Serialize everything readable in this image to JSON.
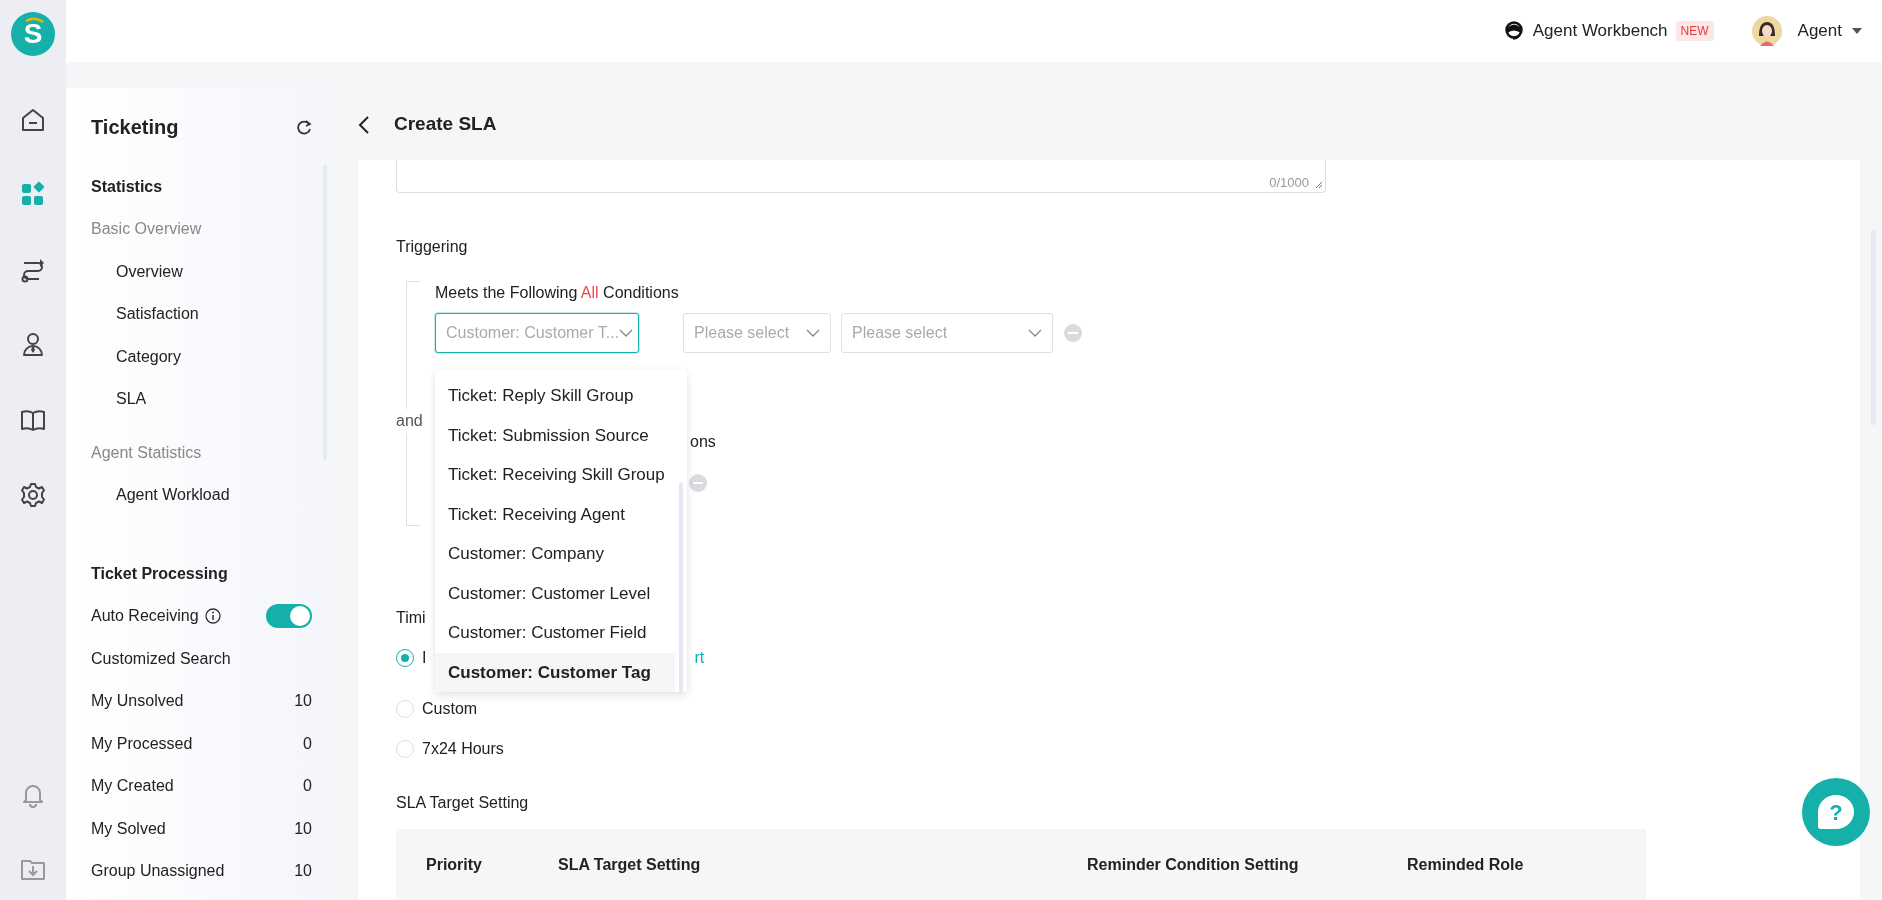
{
  "rail": {
    "logo": "S",
    "items": [
      {
        "kind": "home",
        "selected": false
      },
      {
        "kind": "apps",
        "selected": true
      },
      {
        "kind": "route",
        "selected": false
      },
      {
        "kind": "agent",
        "selected": false
      },
      {
        "kind": "book",
        "selected": false
      },
      {
        "kind": "gear",
        "selected": false
      }
    ],
    "bottom": [
      {
        "kind": "bell"
      },
      {
        "kind": "download"
      }
    ]
  },
  "header": {
    "workbench": "Agent Workbench",
    "badge": "NEW",
    "user": "Agent"
  },
  "sidebar": {
    "title": "Ticketing",
    "statistics": {
      "title": "Statistics",
      "groups": [
        {
          "title": "Basic Overview",
          "items": [
            "Overview",
            "Satisfaction",
            "Category",
            "SLA"
          ]
        },
        {
          "title": "Agent Statistics",
          "items": [
            "Agent Workload"
          ]
        }
      ]
    },
    "processing": {
      "title": "Ticket Processing",
      "items": [
        {
          "kind": "toggle",
          "label": "Auto Receiving",
          "on": true
        },
        {
          "kind": "plain",
          "label": "Customized Search"
        },
        {
          "kind": "count",
          "label": "My Unsolved",
          "count": "10"
        },
        {
          "kind": "count",
          "label": "My Processed",
          "count": "0"
        },
        {
          "kind": "count",
          "label": "My Created",
          "count": "0"
        },
        {
          "kind": "count",
          "label": "My Solved",
          "count": "10"
        },
        {
          "kind": "count",
          "label": "Group Unassigned",
          "count": "10"
        }
      ]
    }
  },
  "page": {
    "title": "Create SLA",
    "counter": "0/1000",
    "triggering": {
      "label": "Triggering",
      "joiner": "and",
      "groups": [
        {
          "title_prefix": "Meets the Following ",
          "title_highlight": "All",
          "title_suffix": " Conditions",
          "selects": [
            {
              "placeholder": "Customer: Customer T...",
              "focused": true
            },
            {
              "placeholder": "Please select",
              "focused": false
            },
            {
              "placeholder": "Please select",
              "focused": false
            }
          ]
        },
        {
          "title_visible": "ons"
        }
      ]
    },
    "dropdown": [
      {
        "label": "Ticket: Reply Skill Group",
        "selected": false
      },
      {
        "label": "Ticket: Submission Source",
        "selected": false
      },
      {
        "label": "Ticket: Receiving Skill Group",
        "selected": false
      },
      {
        "label": "Ticket: Receiving Agent",
        "selected": false
      },
      {
        "label": "Customer: Company",
        "selected": false
      },
      {
        "label": "Customer: Customer Level",
        "selected": false
      },
      {
        "label": "Customer: Customer Field",
        "selected": false
      },
      {
        "label": "Customer: Customer Tag",
        "selected": true
      }
    ],
    "timing": {
      "label": "Timi",
      "options": [
        {
          "label": "I",
          "link": "rt",
          "selected": true
        },
        {
          "label": "Custom",
          "selected": false
        },
        {
          "label": "7x24 Hours",
          "selected": false
        }
      ]
    },
    "target": {
      "label": "SLA Target Setting",
      "columns": [
        "Priority",
        "SLA Target Setting",
        "Reminder Condition Setting",
        "Reminded Role"
      ]
    }
  },
  "help": {
    "label": "?"
  }
}
